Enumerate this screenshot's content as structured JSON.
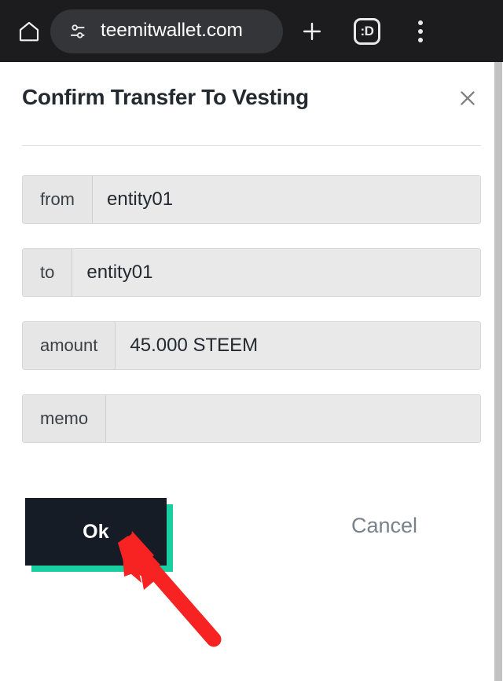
{
  "browser": {
    "home_icon": "home-icon",
    "url_lock_icon": "page-info-tune-icon",
    "url": "teemitwallet.com",
    "new_tab_icon": "plus-icon",
    "tab_count_label": ":D",
    "menu_icon": "more-vertical-icon"
  },
  "dialog": {
    "title": "Confirm Transfer To Vesting",
    "close_icon": "close-icon",
    "fields": [
      {
        "label": "from",
        "value": "entity01"
      },
      {
        "label": "to",
        "value": "entity01"
      },
      {
        "label": "amount",
        "value": "45.000 STEEM"
      },
      {
        "label": "memo",
        "value": ""
      }
    ],
    "ok_label": "Ok",
    "cancel_label": "Cancel"
  },
  "colors": {
    "chrome_bg": "#1c1c1e",
    "url_pill_bg": "#333538",
    "ok_button_bg": "#151c26",
    "ok_shadow_accent": "#19cea0",
    "cancel_text": "#79828a",
    "field_label_bg": "#e6e6e6",
    "field_value_bg": "#e9e9e9",
    "title_text": "#23292e",
    "annotation_arrow": "#f72222"
  },
  "annotation": {
    "arrow_name": "red-pointer-arrow",
    "points_to": "Ok"
  }
}
